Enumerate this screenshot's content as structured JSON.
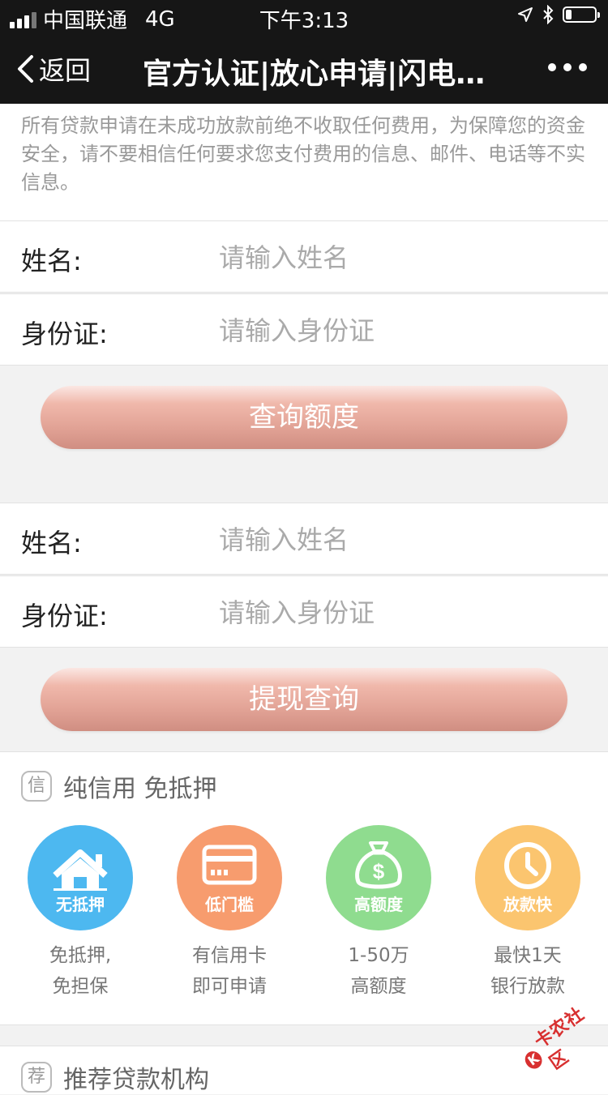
{
  "status_bar": {
    "carrier": "中国联通",
    "network": "4G",
    "time": "下午3:13",
    "battery_level": 0.2
  },
  "nav": {
    "back_label": "返回",
    "title": "官方认证|放心申请|闪电…"
  },
  "notice": {
    "text": "所有贷款申请在未成功放款前绝不收取任何费用，为保障您的资金安全，请不要相信任何要求您支付费用的信息、邮件、电话等不实信息。"
  },
  "form1": {
    "name_label": "姓名:",
    "name_placeholder": "请输入姓名",
    "id_label": "身份证:",
    "id_placeholder": "请输入身份证",
    "button": "查询额度"
  },
  "form2": {
    "name_label": "姓名:",
    "name_placeholder": "请输入姓名",
    "id_label": "身份证:",
    "id_placeholder": "请输入身份证",
    "button": "提现查询"
  },
  "features": {
    "section_icon": "信",
    "section_title": "纯信用 免抵押",
    "items": [
      {
        "icon": "house-icon",
        "badge": "无抵押",
        "line1": "免抵押,",
        "line2": "免担保",
        "color": "#4db8f0"
      },
      {
        "icon": "card-icon",
        "badge": "低门槛",
        "line1": "有信用卡",
        "line2": "即可申请",
        "color": "#f79c6e"
      },
      {
        "icon": "money-bag-icon",
        "badge": "高额度",
        "line1": "1-50万",
        "line2": "高额度",
        "color": "#8fdc8f"
      },
      {
        "icon": "clock-icon",
        "badge": "放款快",
        "line1": "最快1天",
        "line2": "银行放款",
        "color": "#fbc56f"
      }
    ]
  },
  "recommend": {
    "section_icon": "荐",
    "section_title": "推荐贷款机构"
  },
  "watermark": {
    "text": "卡农社区"
  }
}
